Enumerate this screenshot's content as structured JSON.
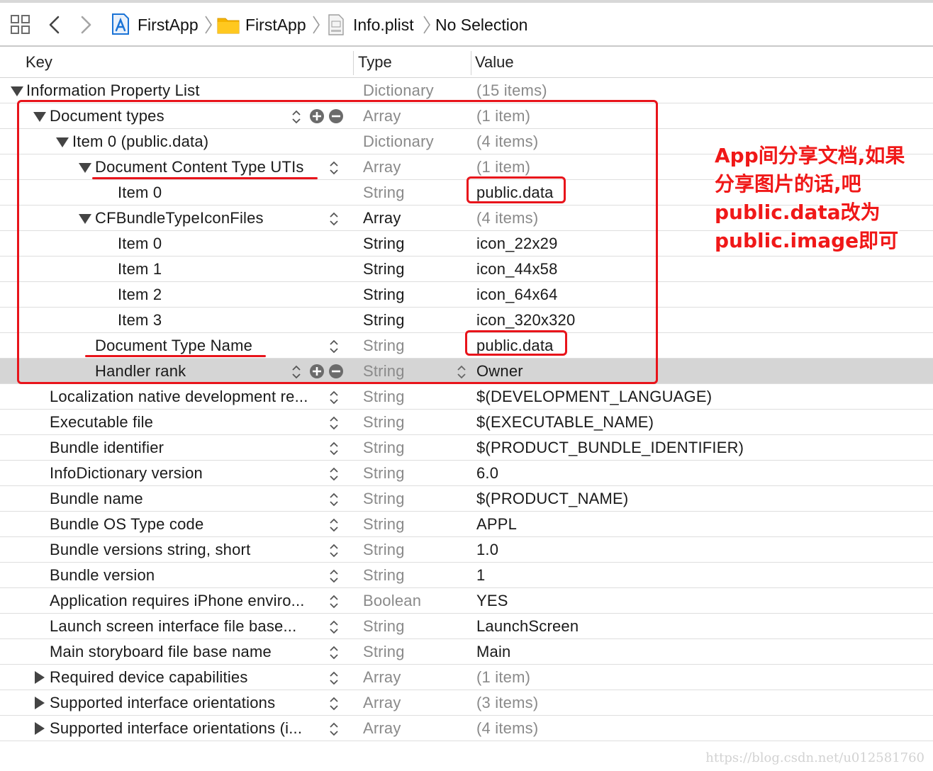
{
  "breadcrumbs": {
    "project": "FirstApp",
    "folder": "FirstApp",
    "file": "Info.plist",
    "selection": "No Selection"
  },
  "columns": {
    "key": "Key",
    "type": "Type",
    "value": "Value"
  },
  "rows": [
    {
      "key": "Information Property List",
      "type": "Dictionary",
      "value": "(15 items)",
      "disclosure": "open"
    },
    {
      "key": "Document types",
      "type": "Array",
      "value": "(1 item)",
      "disclosure": "open",
      "controls": "stepper-plus-minus"
    },
    {
      "key": "Item 0 (public.data)",
      "type": "Dictionary",
      "value": "(4 items)",
      "disclosure": "open"
    },
    {
      "key": "Document Content Type UTIs",
      "type": "Array",
      "value": "(1 item)",
      "disclosure": "open",
      "controls": "stepper"
    },
    {
      "key": "Item 0",
      "type": "String",
      "value": "public.data"
    },
    {
      "key": "CFBundleTypeIconFiles",
      "type": "Array",
      "value": "(4 items)",
      "disclosure": "open",
      "controls": "stepper"
    },
    {
      "key": "Item 0",
      "type": "String",
      "value": "icon_22x29"
    },
    {
      "key": "Item 1",
      "type": "String",
      "value": "icon_44x58"
    },
    {
      "key": "Item 2",
      "type": "String",
      "value": "icon_64x64"
    },
    {
      "key": "Item 3",
      "type": "String",
      "value": "icon_320x320"
    },
    {
      "key": "Document Type Name",
      "type": "String",
      "value": "public.data",
      "controls": "stepper"
    },
    {
      "key": "Handler rank",
      "type": "String",
      "value": "Owner",
      "controls": "stepper-plus-minus",
      "selected": true
    },
    {
      "key": "Localization native development re...",
      "type": "String",
      "value": "$(DEVELOPMENT_LANGUAGE)",
      "controls": "stepper"
    },
    {
      "key": "Executable file",
      "type": "String",
      "value": "$(EXECUTABLE_NAME)",
      "controls": "stepper"
    },
    {
      "key": "Bundle identifier",
      "type": "String",
      "value": "$(PRODUCT_BUNDLE_IDENTIFIER)",
      "controls": "stepper"
    },
    {
      "key": "InfoDictionary version",
      "type": "String",
      "value": "6.0",
      "controls": "stepper"
    },
    {
      "key": "Bundle name",
      "type": "String",
      "value": "$(PRODUCT_NAME)",
      "controls": "stepper"
    },
    {
      "key": "Bundle OS Type code",
      "type": "String",
      "value": "APPL",
      "controls": "stepper"
    },
    {
      "key": "Bundle versions string, short",
      "type": "String",
      "value": "1.0",
      "controls": "stepper"
    },
    {
      "key": "Bundle version",
      "type": "String",
      "value": "1",
      "controls": "stepper"
    },
    {
      "key": "Application requires iPhone enviro...",
      "type": "Boolean",
      "value": "YES",
      "controls": "stepper"
    },
    {
      "key": "Launch screen interface file base...",
      "type": "String",
      "value": "LaunchScreen",
      "controls": "stepper"
    },
    {
      "key": "Main storyboard file base name",
      "type": "String",
      "value": "Main",
      "controls": "stepper"
    },
    {
      "key": "Required device capabilities",
      "type": "Array",
      "value": "(1 item)",
      "disclosure": "closed",
      "controls": "stepper"
    },
    {
      "key": "Supported interface orientations",
      "type": "Array",
      "value": "(3 items)",
      "disclosure": "closed",
      "controls": "stepper"
    },
    {
      "key": "Supported interface orientations (i...",
      "type": "Array",
      "value": "(4 items)",
      "disclosure": "closed",
      "controls": "stepper"
    }
  ],
  "annotation": {
    "lines": [
      "App间分享文档,如果",
      "分享图片的话,吧",
      "public.data改为",
      "public.image即可"
    ],
    "color": "#f01818"
  },
  "watermark": "https://blog.csdn.net/u012581760",
  "colors": {
    "selected_row": "#d5d5d5",
    "muted_text": "#8a8a8a",
    "annotation_red": "#e8141b",
    "folder": "#f5b400",
    "xcode_blue": "#1a73d6"
  }
}
